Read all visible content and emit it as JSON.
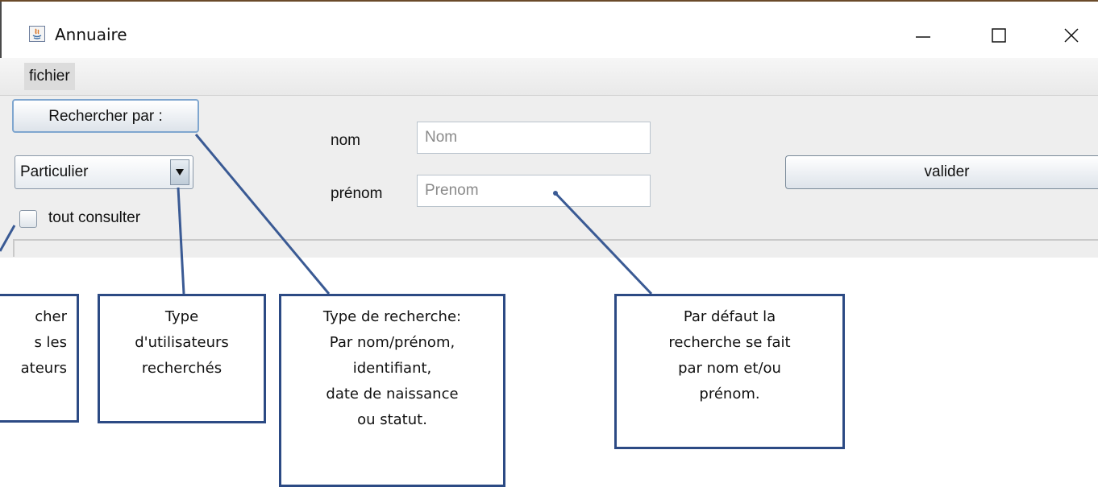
{
  "window": {
    "title": "Annuaire",
    "controls": [
      "minimize",
      "maximize",
      "close"
    ]
  },
  "menu": {
    "items": [
      {
        "label": "fichier"
      }
    ]
  },
  "form": {
    "search_button": "Rechercher par :",
    "user_type": {
      "selected": "Particulier"
    },
    "consult_all_label": "tout consulter",
    "consult_all_checked": false,
    "nom": {
      "label": "nom",
      "placeholder": "Nom"
    },
    "prenom": {
      "label": "prénom",
      "placeholder": "Prenom"
    },
    "submit_button": "valider"
  },
  "callouts": [
    {
      "id": "consult-all",
      "lines": [
        "cher",
        "s les",
        "ateurs"
      ]
    },
    {
      "id": "user-type",
      "lines": [
        "Type",
        "d'utilisateurs",
        "recherchés"
      ]
    },
    {
      "id": "search-type",
      "lines": [
        "Type de recherche:",
        "Par nom/prénom,",
        "identifiant,",
        "date de naissance",
        "ou statut."
      ]
    },
    {
      "id": "default-search",
      "lines": [
        "Par défaut la",
        "recherche se fait",
        "par nom et/ou",
        "prénom."
      ]
    }
  ],
  "colors": {
    "callout_border": "#2c4a84",
    "leader_line": "#3a5a94"
  }
}
